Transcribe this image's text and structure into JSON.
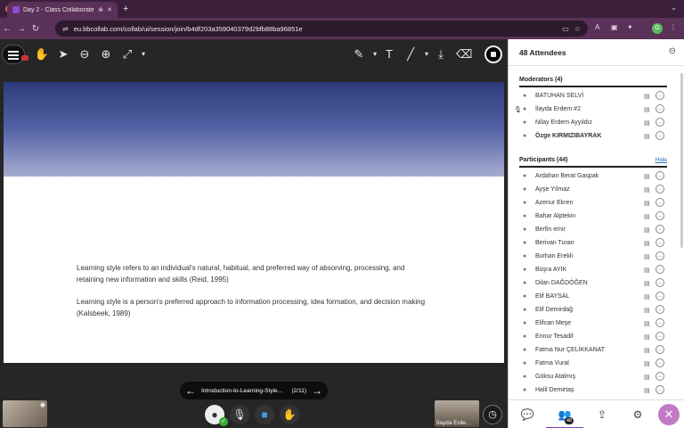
{
  "browser": {
    "tab_title": "Day 2 - Class Collaborate",
    "url": "eu.bbcollab.com/collab/ui/session/join/b4df203a359040379d2bfb88ba96851e",
    "profile_initial": "G"
  },
  "slide": {
    "paragraph1": "Learning style refers to an individual's natural, habitual, and preferred way of absorving, processing, and retaining new information and skills (Reid, 1995)",
    "paragraph2": "Learning style is a person's preferred approach to information processing, idea formation, and decision making (Kalsbeek, 1989)"
  },
  "pager": {
    "file_name": "Introduction-to-Learning-Style...",
    "page": "(2/11)"
  },
  "speaker": {
    "name": "İlayda Erde..."
  },
  "panel": {
    "title": "48 Attendees",
    "moderators_title": "Moderators (4)",
    "participants_title": "Participants (44)",
    "hide_label": "Hide",
    "attendee_count_badge": "48",
    "moderators": [
      "BATUHAN SELVİ",
      "İlayda Erdem #2",
      "Nilay Erdem Ayyıldız",
      "Özge KIRMIZIBAYRAK"
    ],
    "participants": [
      "Ardahan Berat Gaspak",
      "Ayşe Yılmaz",
      "Azenur Ekren",
      "Bahar Alptekin",
      "Berfin emir",
      "Berivan Turan",
      "Burhan Erekli",
      "Büşra AYIK",
      "Dilan DAĞDÖĞEN",
      "Elif BAYSAL",
      "Elif Demirdağ",
      "Elifcan Meşe",
      "Ennur Tesadif",
      "Fatma Nur ÇELİKKANAT",
      "Fatma Vural",
      "Göksu Atalmış",
      "Halil Demirtaş"
    ]
  },
  "colors": {
    "accent": "#7a3db8",
    "close_button": "#c37ac4",
    "browser_frame": "#5a3158"
  }
}
